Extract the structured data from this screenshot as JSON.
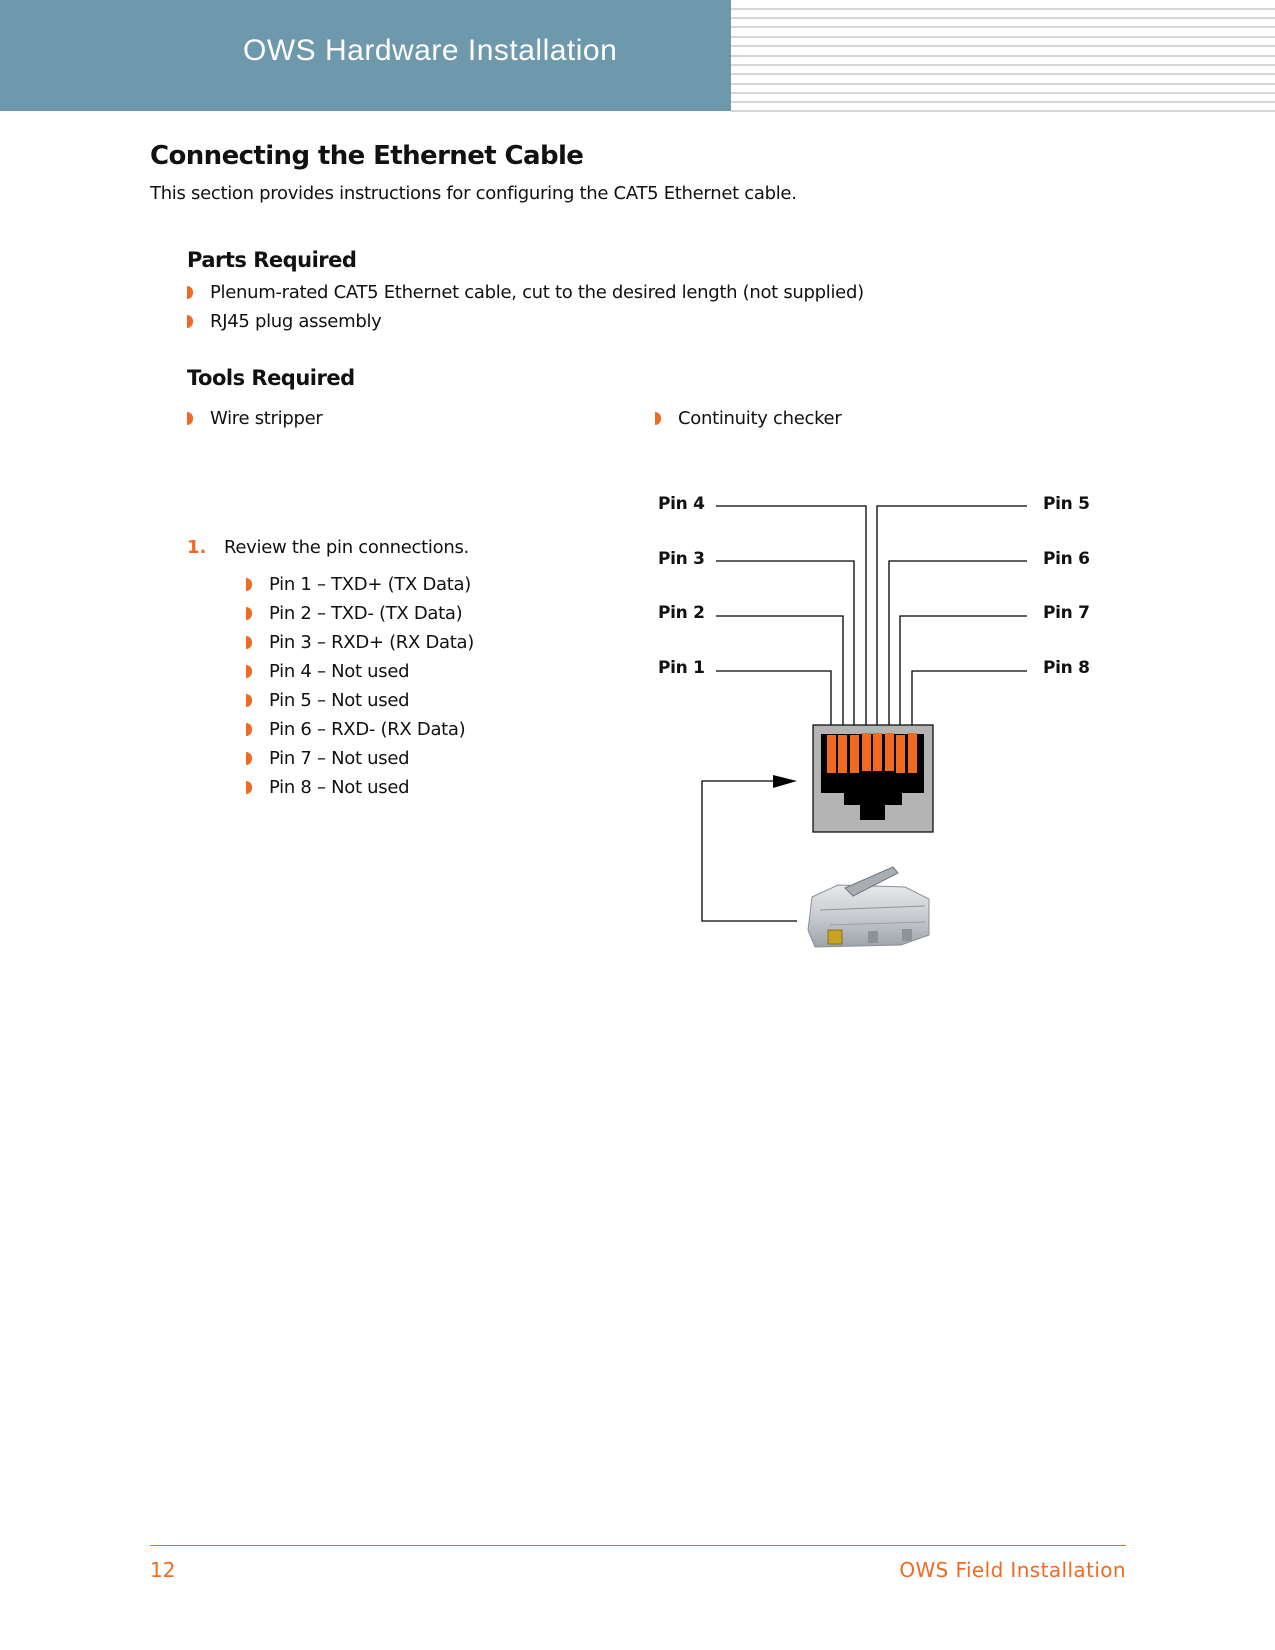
{
  "header": {
    "title": "OWS Hardware Installation"
  },
  "section": {
    "title": "Connecting the Ethernet Cable",
    "intro": "This section provides instructions for configuring the CAT5 Ethernet cable."
  },
  "parts": {
    "heading": "Parts Required",
    "items": [
      "Plenum-rated CAT5 Ethernet cable, cut to the desired length (not supplied)",
      "RJ45 plug assembly"
    ]
  },
  "tools": {
    "heading": "Tools Required",
    "items": [
      "Wire stripper",
      "Continuity checker"
    ]
  },
  "steps": [
    {
      "number": "1.",
      "text": "Review the pin connections.",
      "pins": [
        "Pin 1 – TXD+ (TX Data)",
        "Pin 2 – TXD- (TX Data)",
        "Pin 3 – RXD+ (RX Data)",
        "Pin 4 – Not used",
        "Pin 5 – Not used",
        "Pin 6 – RXD- (RX Data)",
        "Pin 7 – Not used",
        "Pin 8 – Not used"
      ]
    }
  ],
  "diagram": {
    "left_labels": [
      "Pin 4",
      "Pin 3",
      "Pin 2",
      "Pin 1"
    ],
    "right_labels": [
      "Pin 5",
      "Pin 6",
      "Pin 7",
      "Pin 8"
    ],
    "jack_icon": "rj45-jack-icon",
    "plug_icon": "rj45-plug-icon"
  },
  "colors": {
    "header_band": "#6e98ab",
    "accent": "#f06a22",
    "contact": "#f26a21",
    "jack_body": "#b4b4b4"
  },
  "footer": {
    "page_number": "12",
    "title": "OWS Field Installation"
  }
}
